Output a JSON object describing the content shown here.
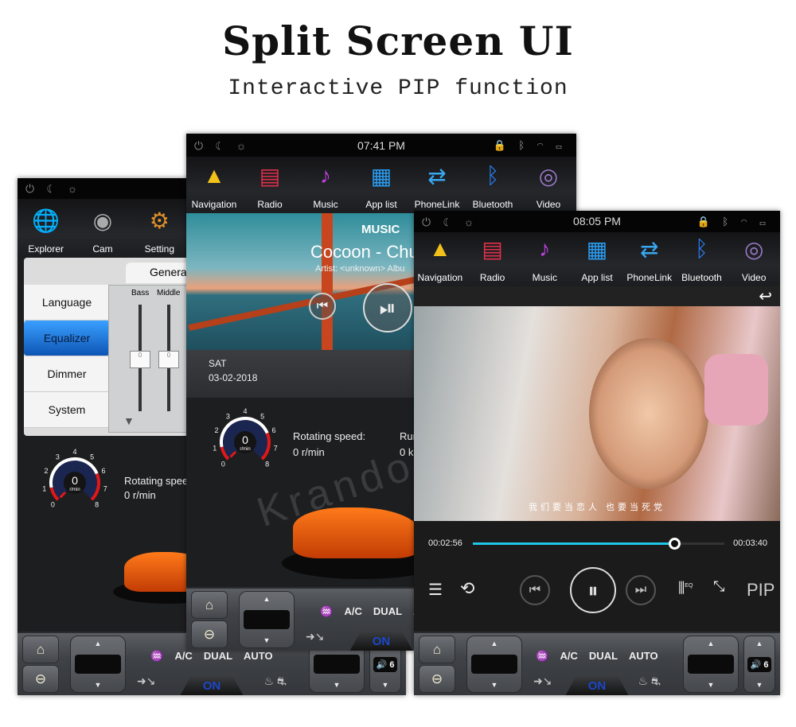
{
  "header": {
    "title": "Split Screen UI",
    "subtitle": "Interactive PIP function"
  },
  "status_icons": {
    "left": "power-icon moon-icon brightness-icon",
    "right": "lock-icon bluetooth-icon wifi-icon recent-apps-icon"
  },
  "left": {
    "apps": [
      {
        "label": "Explorer",
        "icon": "globe-icon"
      },
      {
        "label": "Cam",
        "icon": "camera-icon"
      },
      {
        "label": "Setting",
        "icon": "gear-icon"
      }
    ],
    "settings": {
      "tab": "Genera",
      "menu": [
        "Language",
        "Equalizer",
        "Dimmer",
        "System"
      ],
      "selected": "Equalizer",
      "eq_labels": [
        "Bass",
        "Middle"
      ],
      "eq_values": [
        "0",
        "0"
      ]
    },
    "rotating_label": "Rotating spee",
    "rotating_value": "0 r/min"
  },
  "middle": {
    "time": "07:41 PM",
    "apps": [
      {
        "label": "Navigation",
        "icon": "navigation-icon"
      },
      {
        "label": "Radio",
        "icon": "radio-icon"
      },
      {
        "label": "Music",
        "icon": "music-icon"
      },
      {
        "label": "App list",
        "icon": "app-list-icon"
      },
      {
        "label": "PhoneLink",
        "icon": "phonelink-icon"
      },
      {
        "label": "Bluetooth",
        "icon": "bluetooth-icon"
      },
      {
        "label": "Video",
        "icon": "video-icon"
      }
    ],
    "music": {
      "label": "MUSIC",
      "title": "Cocoon - Chu",
      "artist": "Artist: <unknown>  Albu"
    },
    "date": {
      "day": "SAT",
      "date": "03-02-2018"
    },
    "rotating_label": "Rotating speed:",
    "rotating_value": "0 r/min",
    "run_label": "Run",
    "run_value": "0 k"
  },
  "right": {
    "time": "08:05 PM",
    "apps": [
      {
        "label": "Navigation",
        "icon": "navigation-icon"
      },
      {
        "label": "Radio",
        "icon": "radio-icon"
      },
      {
        "label": "Music",
        "icon": "music-icon"
      },
      {
        "label": "App list",
        "icon": "app-list-icon"
      },
      {
        "label": "PhoneLink",
        "icon": "phonelink-icon"
      },
      {
        "label": "Bluetooth",
        "icon": "bluetooth-icon"
      },
      {
        "label": "Video",
        "icon": "video-icon"
      }
    ],
    "video": {
      "subtitle": "我们要当恋人 也要当死党",
      "elapsed": "00:02:56",
      "total": "00:03:40",
      "progress": 0.8,
      "pip": "PIP",
      "eq": "EQ"
    }
  },
  "gauge": {
    "ticks": [
      "0",
      "1",
      "2",
      "3",
      "4",
      "5",
      "6",
      "7",
      "8"
    ],
    "value": "0",
    "unit": "r/min"
  },
  "climate": {
    "ac": "A/C",
    "dual": "DUAL",
    "auto": "AUTO",
    "on": "ON",
    "volume": "6"
  },
  "colors": {
    "accent": "#1ec8e6",
    "selected": "#1670d0",
    "gauge_red": "#e01818"
  },
  "watermark": "Krando"
}
